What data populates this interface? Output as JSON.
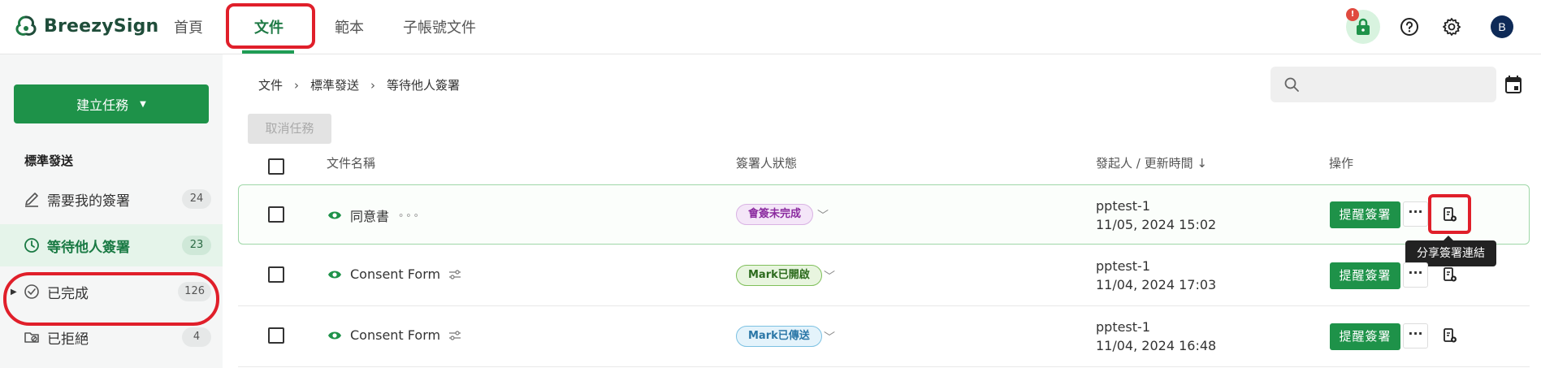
{
  "app": {
    "name": "BreezySign"
  },
  "nav": {
    "home": "首頁",
    "files": "文件",
    "templates": "範本",
    "sub_files": "子帳號文件"
  },
  "header_icons": {
    "badge": "!",
    "lock": "lock-icon",
    "help": "help-icon",
    "settings": "gear-icon",
    "avatar_letter": "B"
  },
  "sidebar": {
    "create_task": "建立任務",
    "section_title": "標準發送",
    "items": [
      {
        "label": "需要我的簽署",
        "count": "24",
        "icon": "pen-icon"
      },
      {
        "label": "等待他人簽署",
        "count": "23",
        "icon": "clock-icon"
      },
      {
        "label": "已完成",
        "count": "126",
        "icon": "check-circle-icon"
      },
      {
        "label": "已拒絕",
        "count": "4",
        "icon": "folder-deny-icon"
      }
    ]
  },
  "breadcrumb": [
    "文件",
    "標準發送",
    "等待他人簽署"
  ],
  "search": {
    "placeholder": ""
  },
  "toolbar": {
    "cancel_task": "取消任務"
  },
  "table": {
    "headers": {
      "name": "文件名稱",
      "status": "簽署人狀態",
      "sender": "發起人 / 更新時間",
      "actions": "操作"
    },
    "rows": [
      {
        "name": "同意書",
        "status": "會簽未完成",
        "status_color": "#8a2a9f",
        "sender": "pptest-1",
        "time": "11/05, 2024 15:02",
        "remind": "提醒簽署"
      },
      {
        "name": "Consent Form",
        "status": "Mark已開啟",
        "status_color": "#2c6b1d",
        "sender": "pptest-1",
        "time": "11/04, 2024 17:03",
        "remind": "提醒簽署"
      },
      {
        "name": "Consent Form",
        "status": "Mark已傳送",
        "status_color": "#2b77a7",
        "sender": "pptest-1",
        "time": "11/04, 2024 16:48",
        "remind": "提醒簽署"
      }
    ]
  },
  "tooltip": {
    "share_link": "分享簽署連結"
  },
  "colors": {
    "brand": "#1e9249",
    "highlight": "#e01f2a"
  }
}
